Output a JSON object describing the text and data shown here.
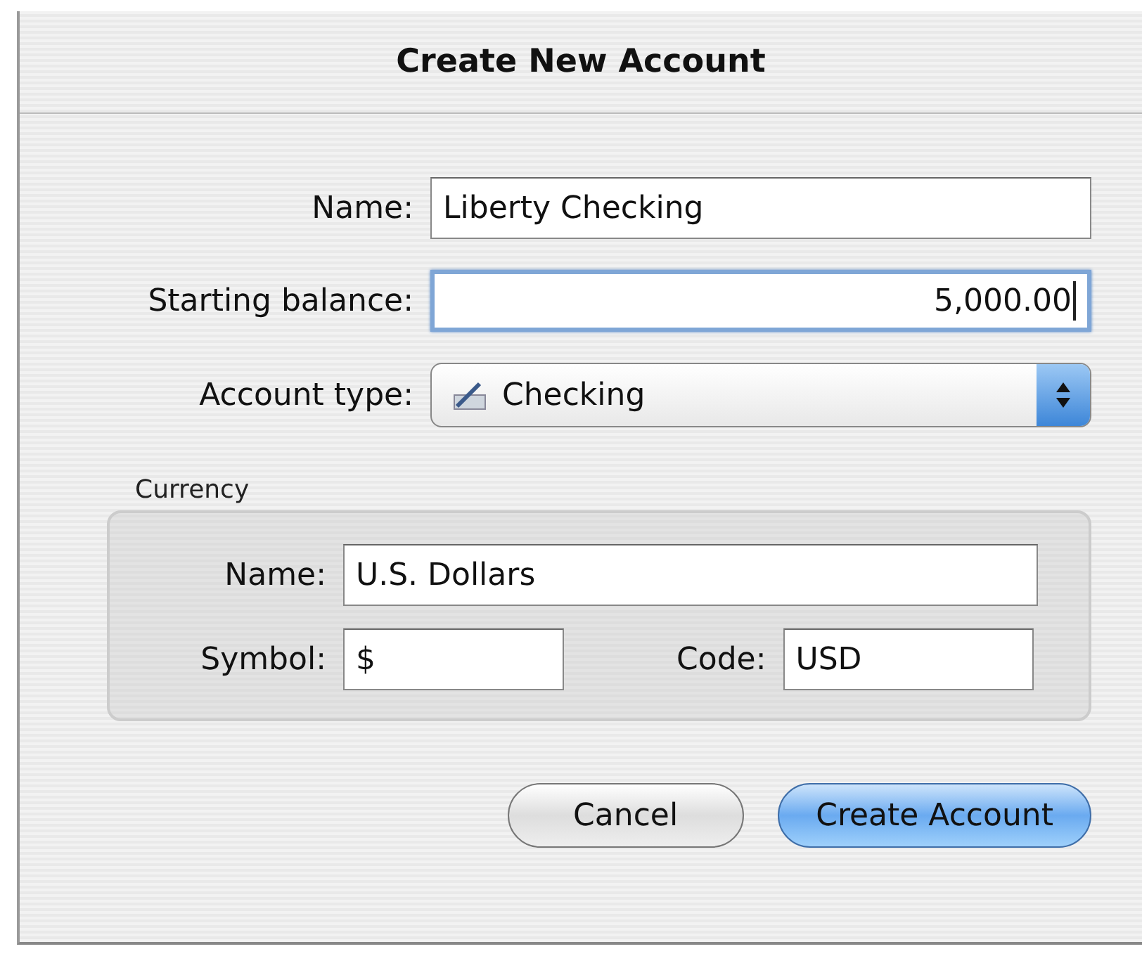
{
  "window": {
    "title": "Create New Account"
  },
  "fields": [
    {
      "label": "Name:",
      "value": "Liberty Checking",
      "focused": false,
      "kind": "text"
    },
    {
      "label": "Starting balance:",
      "value": "5,000.00",
      "focused": true,
      "kind": "number"
    }
  ],
  "account_type": {
    "label": "Account type:",
    "value": "Checking"
  },
  "currency": {
    "title": "Currency",
    "name": {
      "label": "Name:",
      "value": "U.S. Dollars"
    },
    "symbol": {
      "label": "Symbol:",
      "value": "$"
    },
    "code": {
      "label": "Code:",
      "value": "USD"
    }
  },
  "buttons": [
    {
      "label": "Cancel",
      "default": false
    },
    {
      "label": "Create Account",
      "default": true
    }
  ]
}
